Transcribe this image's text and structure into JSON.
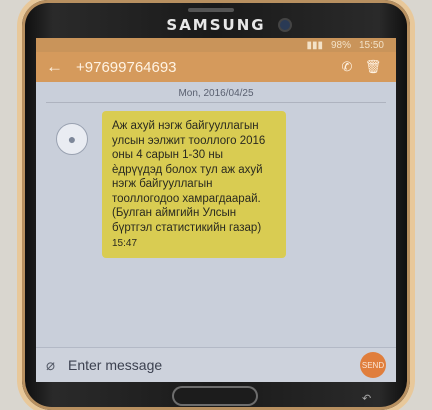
{
  "device": {
    "brand": "SAMSUNG"
  },
  "status": {
    "battery": "98%",
    "time": "15:50"
  },
  "header": {
    "back_icon": "←",
    "phone_number": "+97699764693",
    "call_icon": "phone-icon",
    "delete_icon": "trash-icon"
  },
  "thread": {
    "date": "Mon, 2016/04/25",
    "message": {
      "text": "Аж ахуй нэгж байгууллагын улсын ээлжит тооллого 2016 оны 4 сарын 1-30 ны ѐдрүүдэд болох тул аж ахуй нэгж байгууллагын тооллогодоо хамрагдаарай. (Булган аймгийн Улсын бүртгэл статистикийн газар)",
      "time": "15:47"
    }
  },
  "composer": {
    "placeholder": "Enter message",
    "send_label": "SEND"
  }
}
